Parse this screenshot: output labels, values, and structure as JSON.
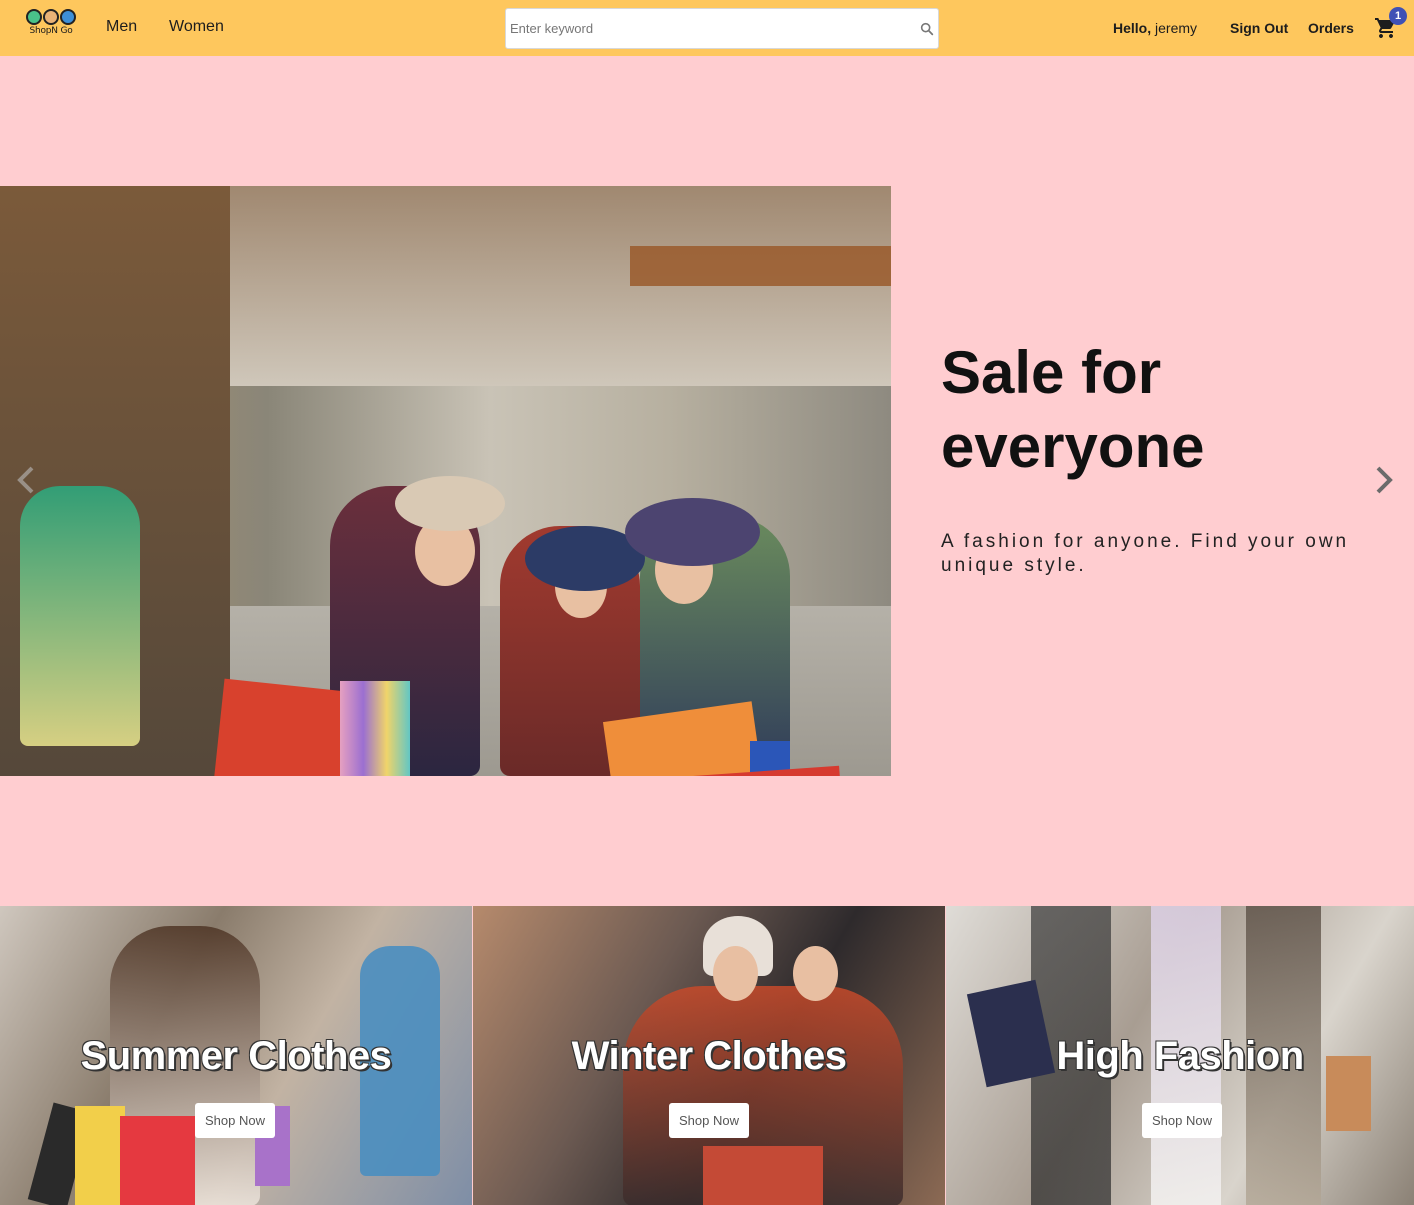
{
  "header": {
    "logo_text": "ShopN Go",
    "nav": [
      {
        "label": "Men"
      },
      {
        "label": "Women"
      }
    ],
    "search": {
      "placeholder": "Enter keyword",
      "value": ""
    },
    "greeting": {
      "prefix": "Hello,",
      "username": "jeremy"
    },
    "sign_out_label": "Sign Out",
    "orders_label": "Orders",
    "cart_count": "1"
  },
  "hero": {
    "title": "Sale for everyone",
    "subtitle": "A fashion for anyone. Find your own unique style."
  },
  "categories": [
    {
      "title": "Summer Clothes",
      "button": "Shop Now"
    },
    {
      "title": "Winter Clothes",
      "button": "Shop Now"
    },
    {
      "title": "High Fashion",
      "button": "Shop Now"
    }
  ],
  "colors": {
    "header_bg": "#fec75d",
    "page_bg": "#ffcdd0",
    "badge": "#3f51b5"
  },
  "icons": [
    "search-icon",
    "cart-icon",
    "chevron-left-icon",
    "chevron-right-icon"
  ]
}
